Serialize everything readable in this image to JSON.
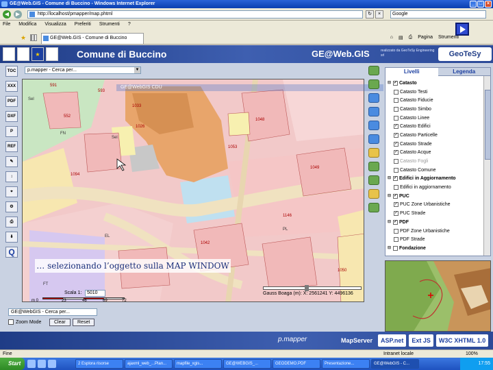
{
  "window": {
    "title": "GE@Web.GIS - Comune di Buccino - Windows Internet Explorer"
  },
  "address": {
    "url": "http://localhost/pmapper/map.phtml",
    "search_placeholder": "Google"
  },
  "menubar": [
    "File",
    "Modifica",
    "Visualizza",
    "Preferiti",
    "Strumenti",
    "?"
  ],
  "tab": {
    "label": "GE@Web.GIS - Comune di Buccino"
  },
  "commandbar": {
    "page": "Pagina",
    "tools": "Strumenti"
  },
  "banner": {
    "title": "Comune di Buccino",
    "brand": "GE@Web.GIS",
    "partner": "realizzato da GeoTeSy Engineering srl",
    "partner_logo": "GeoTeSy",
    "eu_logo": "★"
  },
  "map_selector": {
    "value": "p.mapper - Cerca per..."
  },
  "cdu_title": "GE@WebGIS CDU",
  "left_tools": [
    "TOC",
    "XXX",
    "PDF",
    "DXF",
    "P",
    "REF",
    "Q"
  ],
  "map_caption": "… selezionando l’oggetto sulla MAP WINDOW",
  "parcel_labels": [
    "591",
    "593",
    "552",
    "1033",
    "1026",
    "1048",
    "1053",
    "1049",
    "1146",
    "1042",
    "1094",
    "1050",
    "Sel",
    "Sel",
    "FN",
    "FT",
    "EL",
    "PL"
  ],
  "scale": {
    "label": "Scala 1:",
    "value": "5010",
    "ticks": [
      "m 0",
      "23",
      "46",
      "69",
      "72"
    ]
  },
  "coords": "Gauss Boaga (m): X: 2561241  Y: 4496136",
  "bottom_form": {
    "select_value": "GE@WebGIS - Cerca per...",
    "zoom_mode": "Zoom Mode",
    "clear": "Clear",
    "reset": "Reset"
  },
  "layers_panel": {
    "tabs": [
      "Livelli",
      "Legenda"
    ],
    "rows": [
      {
        "label": "Catasto",
        "checked": true,
        "group": true
      },
      {
        "label": "Catasto Testi",
        "checked": false
      },
      {
        "label": "Catasto Fiducie",
        "checked": false
      },
      {
        "label": "Catasto Simbo",
        "checked": false
      },
      {
        "label": "Catasto Linee",
        "checked": false
      },
      {
        "label": "Catasto Edifici",
        "checked": true
      },
      {
        "label": "Catasto Particelle",
        "checked": true
      },
      {
        "label": "Catasto Strade",
        "checked": true
      },
      {
        "label": "Catasto Acque",
        "checked": true
      },
      {
        "label": "Catasto Fogli",
        "checked": false,
        "disabled": true
      },
      {
        "label": "Catasto Comune",
        "checked": false
      },
      {
        "label": "Edifici in Aggiornamento",
        "checked": true,
        "group": true
      },
      {
        "label": "Edifici in aggiornamento",
        "checked": false
      },
      {
        "label": "PUC",
        "checked": true,
        "group": true
      },
      {
        "label": "PUC Zone Urbanistiche",
        "checked": true
      },
      {
        "label": "PUC Strade",
        "checked": true
      },
      {
        "label": "PDF",
        "checked": true,
        "group": true
      },
      {
        "label": "PDF Zone Urbanistiche",
        "checked": false
      },
      {
        "label": "PDF Strade",
        "checked": false
      },
      {
        "label": "Fondazione",
        "checked": false,
        "group": true
      }
    ]
  },
  "footer": {
    "pmapper": "p.mapper",
    "badges": [
      "MapServer",
      "ASP.net",
      "Ext JS",
      "W3C XHTML 1.0"
    ]
  },
  "status": {
    "text": "Fine",
    "zone": "Intranet locale",
    "zoom": "100%"
  },
  "taskbar": {
    "start": "Start",
    "tasks": [
      "2 Esplora risorse",
      "ajaxml_web_...Plan...",
      "mapfile_xgis...",
      "GE@WEBGIS_...",
      "GEODEMO.PDF",
      "Presentazione...",
      "GE@WebGIS - C..."
    ],
    "clock": "17:55"
  },
  "colors": {
    "accent": "#1f3c86",
    "map_pink": "#f2c9c9",
    "map_orange": "#e8a56b",
    "map_road": "#f0e2c0"
  }
}
